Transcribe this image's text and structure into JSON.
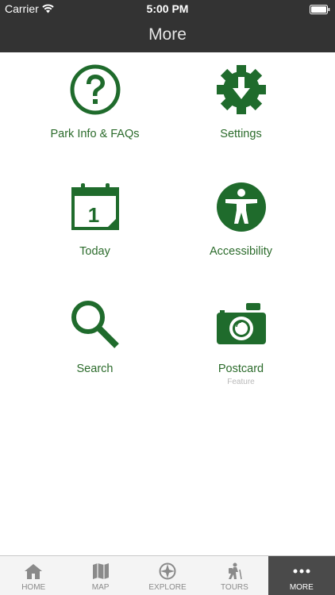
{
  "status_bar": {
    "carrier": "Carrier",
    "time": "5:00 PM"
  },
  "nav": {
    "title": "More"
  },
  "accent_color": "#1f6b2c",
  "menu": [
    {
      "label": "Park Info & FAQs",
      "icon": "question-circle-icon"
    },
    {
      "label": "Settings",
      "icon": "gear-download-icon"
    },
    {
      "label": "Today",
      "icon": "calendar-icon"
    },
    {
      "label": "Accessibility",
      "icon": "accessibility-icon"
    },
    {
      "label": "Search",
      "icon": "magnifier-icon"
    },
    {
      "label": "Postcard",
      "sublabel": "Feature",
      "icon": "camera-icon"
    }
  ],
  "calendar_day": "1",
  "tabs": [
    {
      "label": "HOME",
      "icon": "house-icon"
    },
    {
      "label": "MAP",
      "icon": "map-icon"
    },
    {
      "label": "EXPLORE",
      "icon": "compass-icon"
    },
    {
      "label": "TOURS",
      "icon": "hiker-icon"
    },
    {
      "label": "MORE",
      "icon": "ellipsis-icon",
      "active": true
    }
  ]
}
